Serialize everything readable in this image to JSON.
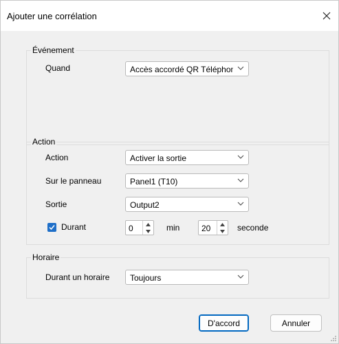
{
  "window": {
    "title": "Ajouter une corrélation"
  },
  "event_group": {
    "legend": "Événement",
    "when_label": "Quand",
    "when_value": "Accès accordé QR Téléphone"
  },
  "action_group": {
    "legend": "Action",
    "action_label": "Action",
    "action_value": "Activer la sortie",
    "panel_label": "Sur le panneau",
    "panel_value": "Panel1 (T10)",
    "output_label": "Sortie",
    "output_value": "Output2",
    "during_label": "Durant",
    "during_checked": true,
    "minutes_value": "0",
    "minutes_unit": "min",
    "seconds_value": "20",
    "seconds_unit": "seconde"
  },
  "schedule_group": {
    "legend": "Horaire",
    "schedule_label": "Durant un horaire",
    "schedule_value": "Toujours"
  },
  "buttons": {
    "ok": "D'accord",
    "cancel": "Annuler"
  },
  "colors": {
    "accent": "#0067c0",
    "checkbox": "#1f6fc8",
    "background": "#f0f0f0"
  }
}
